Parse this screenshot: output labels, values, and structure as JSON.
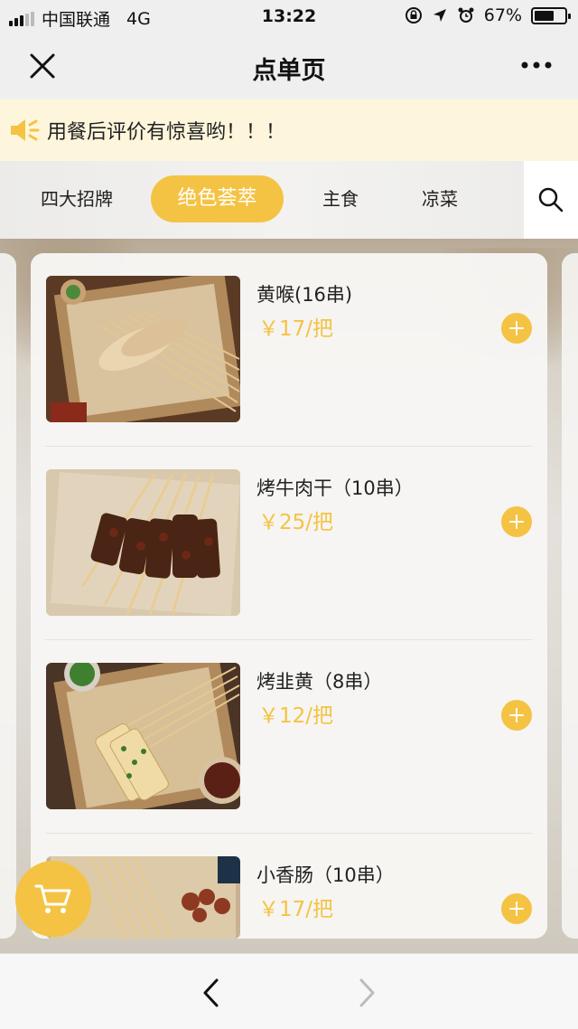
{
  "status_bar": {
    "carrier": "中国联通",
    "network": "4G",
    "time": "13:22",
    "battery": "67%",
    "battery_level": 0.67
  },
  "nav": {
    "title": "点单页",
    "close_icon": "close-icon",
    "more_icon": "more-icon"
  },
  "notice": {
    "icon": "speaker-icon",
    "text": "用餐后评价有惊喜哟！！！"
  },
  "tabs": [
    {
      "label": "四大招牌",
      "active": false
    },
    {
      "label": "绝色荟萃",
      "active": true
    },
    {
      "label": "主食",
      "active": false
    },
    {
      "label": "凉菜",
      "active": false
    }
  ],
  "menu_items": [
    {
      "name": "黄喉(16串)",
      "price": "￥17/把"
    },
    {
      "name": "烤牛肉干（10串）",
      "price": "￥25/把"
    },
    {
      "name": "烤韭黄（8串）",
      "price": "￥12/把"
    },
    {
      "name": "小香肠（10串）",
      "price": "￥17/把"
    }
  ],
  "colors": {
    "accent": "#f4c343",
    "notice_bg": "#fdf6dc"
  },
  "icons": {
    "search": "search-icon",
    "cart": "cart-icon",
    "add": "add-icon",
    "back": "chevron-left-icon",
    "forward": "chevron-right-icon"
  }
}
